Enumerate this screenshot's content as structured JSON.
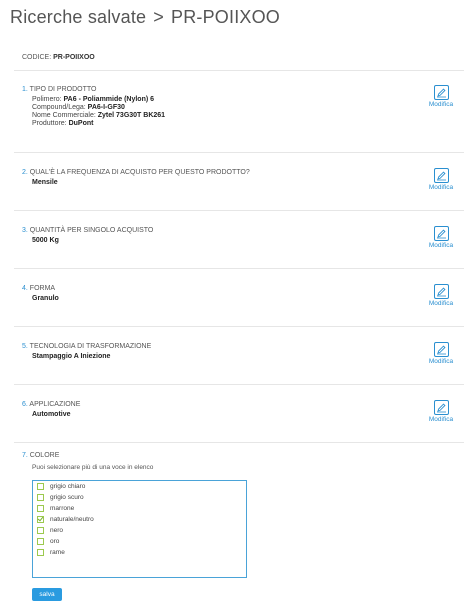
{
  "header": {
    "breadcrumb_root": "Ricerche salvate",
    "breadcrumb_sep": ">",
    "breadcrumb_current": "PR-POIIXOO"
  },
  "code": {
    "label": "CODICE:",
    "value": "PR-POIIXOO"
  },
  "sections": [
    {
      "num": "1.",
      "title": "TIPO DI PRODOTTO",
      "details": [
        {
          "label": "Polimero:",
          "value": "PA6 - Poliammide (Nylon) 6"
        },
        {
          "label": "Compound/Lega:",
          "value": "PA6-I-GF30"
        },
        {
          "label": "Nome Commerciale:",
          "value": "Zytel 73G30T BK261"
        },
        {
          "label": "Produttore:",
          "value": "DuPont"
        }
      ]
    },
    {
      "num": "2.",
      "title": "QUAL'È LA FREQUENZA DI ACQUISTO PER QUESTO PRODOTTO?",
      "value": "Mensile"
    },
    {
      "num": "3.",
      "title": "QUANTITÀ PER SINGOLO ACQUISTO",
      "value": "5000 Kg"
    },
    {
      "num": "4.",
      "title": "FORMA",
      "value": "Granulo"
    },
    {
      "num": "5.",
      "title": "TECNOLOGIA DI TRASFORMAZIONE",
      "value": "Stampaggio A Iniezione"
    },
    {
      "num": "6.",
      "title": "APPLICAZIONE",
      "value": "Automotive"
    }
  ],
  "modifica_label": "Modifica",
  "colore": {
    "num": "7.",
    "title": "COLORE",
    "hint": "Puoi selezionare più di una voce in elenco",
    "options": [
      {
        "label": "grigio chiaro",
        "checked": false
      },
      {
        "label": "grigio scuro",
        "checked": false
      },
      {
        "label": "marrone",
        "checked": false
      },
      {
        "label": "naturale/neutro",
        "checked": true
      },
      {
        "label": "nero",
        "checked": false
      },
      {
        "label": "oro",
        "checked": false
      },
      {
        "label": "rame",
        "checked": false
      }
    ],
    "save_label": "salva"
  },
  "colors": {
    "accent": "#2a8fd0",
    "checkbox": "#9cc94f",
    "button": "#2a9be0"
  },
  "icons": {
    "edit": "pencil-icon"
  }
}
